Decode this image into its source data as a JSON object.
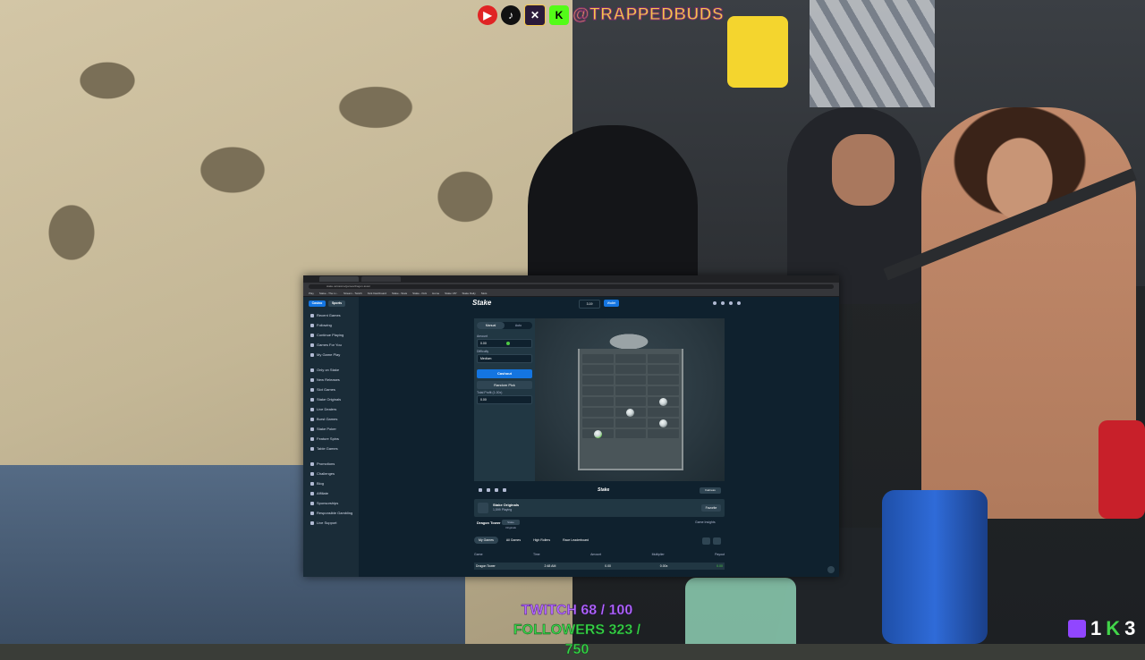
{
  "overlay": {
    "social_handle": "@TRAPPEDBUDS",
    "goal_line1": "TWITCH 68 / 100",
    "goal_line2": "FOLLOWERS 323 / 750",
    "badge_count1": "1",
    "badge_count2": "3",
    "badge_k": "K"
  },
  "browser": {
    "url": "stake.us/casino/games/dragon-tower",
    "bookmarks": [
      "Play",
      "Stake - The Li...",
      "Stream - Twitch",
      "Kick Dashboard",
      "Stake - Stats",
      "Stake - Kick",
      "Home",
      "Stake VIP",
      "Stake Daily",
      "Slots"
    ]
  },
  "sidebar": {
    "casino_label": "Casino",
    "sports_label": "Sports",
    "items_group1": [
      "Recent Games",
      "Following",
      "Continue Playing",
      "Games For You",
      "My Game Play"
    ],
    "items_group2": [
      "Only on Stake",
      "New Releases",
      "Slot Games",
      "Stake Originals",
      "Live Dealers",
      "Burst Games",
      "Stake Poker",
      "Feature Spins",
      "Table Games"
    ],
    "items_group3": [
      "Promotions",
      "Challenges",
      "Blog",
      "Affiliate",
      "Sponsorships",
      "Responsible Gambling",
      "Live Support"
    ]
  },
  "topnav": {
    "logo": "Stake",
    "balance": "3.19",
    "wallet_label": "Wallet"
  },
  "controls": {
    "mode_manual": "Manual",
    "mode_auto": "Auto",
    "amount_label": "Amount",
    "amount_value": "0.00",
    "difficulty_label": "Difficulty",
    "difficulty_value": "Medium",
    "cashout_label": "Cashout",
    "random_label": "Random Pick",
    "profit_label": "Total Profit (1.00x)",
    "profit_value": "0.00"
  },
  "tower": {
    "rows": [
      [
        "",
        "",
        ""
      ],
      [
        "",
        "",
        ""
      ],
      [
        "",
        "",
        ""
      ],
      [
        "",
        "",
        ""
      ],
      [
        "win",
        "win",
        "win"
      ],
      [
        "",
        "",
        "egg"
      ],
      [
        "",
        "egg",
        ""
      ],
      [
        "",
        "",
        "egg"
      ],
      [
        "egg-g",
        "",
        ""
      ]
    ]
  },
  "gamefoot": {
    "logo": "Stake",
    "fairness": "Fairness"
  },
  "info": {
    "title": "Stake Originals",
    "subtitle": "1,599 Playing",
    "fav_label": "Favorite",
    "game_name": "Dragon Tower",
    "tag": "Stake Originals",
    "more": "Game Insights"
  },
  "bets": {
    "filters": [
      "My Games",
      "All Games",
      "High Rollers",
      "Race Leaderboard"
    ],
    "headers": [
      "Game",
      "Time",
      "Amount",
      "Multiplier",
      "Payout"
    ],
    "row": [
      "Dragon Tower",
      "2:48 AM",
      "0.00",
      "0.00x",
      "0.00"
    ]
  }
}
